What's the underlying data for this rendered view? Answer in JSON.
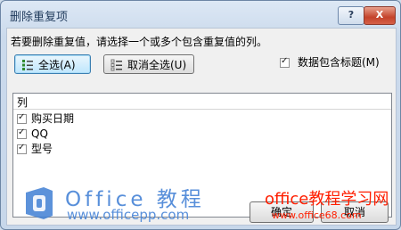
{
  "window": {
    "title": "删除重复项",
    "help_label": "?",
    "close_label": "X"
  },
  "dialog": {
    "instruction": "若要删除重复值，请选择一个或多个包含重复值的列。",
    "select_all_label": "全选(A)",
    "unselect_all_label": "取消全选(U)",
    "has_headers_label": "数据包含标题(M)",
    "has_headers_checked": true,
    "list_header": "列",
    "columns": [
      {
        "label": "购买日期",
        "checked": true
      },
      {
        "label": "QQ",
        "checked": true
      },
      {
        "label": "型号",
        "checked": true
      }
    ],
    "ok_label": "确定",
    "cancel_label": "取消"
  },
  "watermarks": {
    "office_brand": "Office 教程",
    "office_url": "www.officepp.com",
    "office68_text": "office教程学习网",
    "office68_url": "www.office68.com"
  },
  "colors": {
    "title_text": "#1e395b",
    "watermark_blue": "#4a86d7",
    "watermark_red": "#ff1e00"
  },
  "icons": {
    "select_all": "checklist-icon",
    "unselect_all": "unchecked-list-icon"
  }
}
